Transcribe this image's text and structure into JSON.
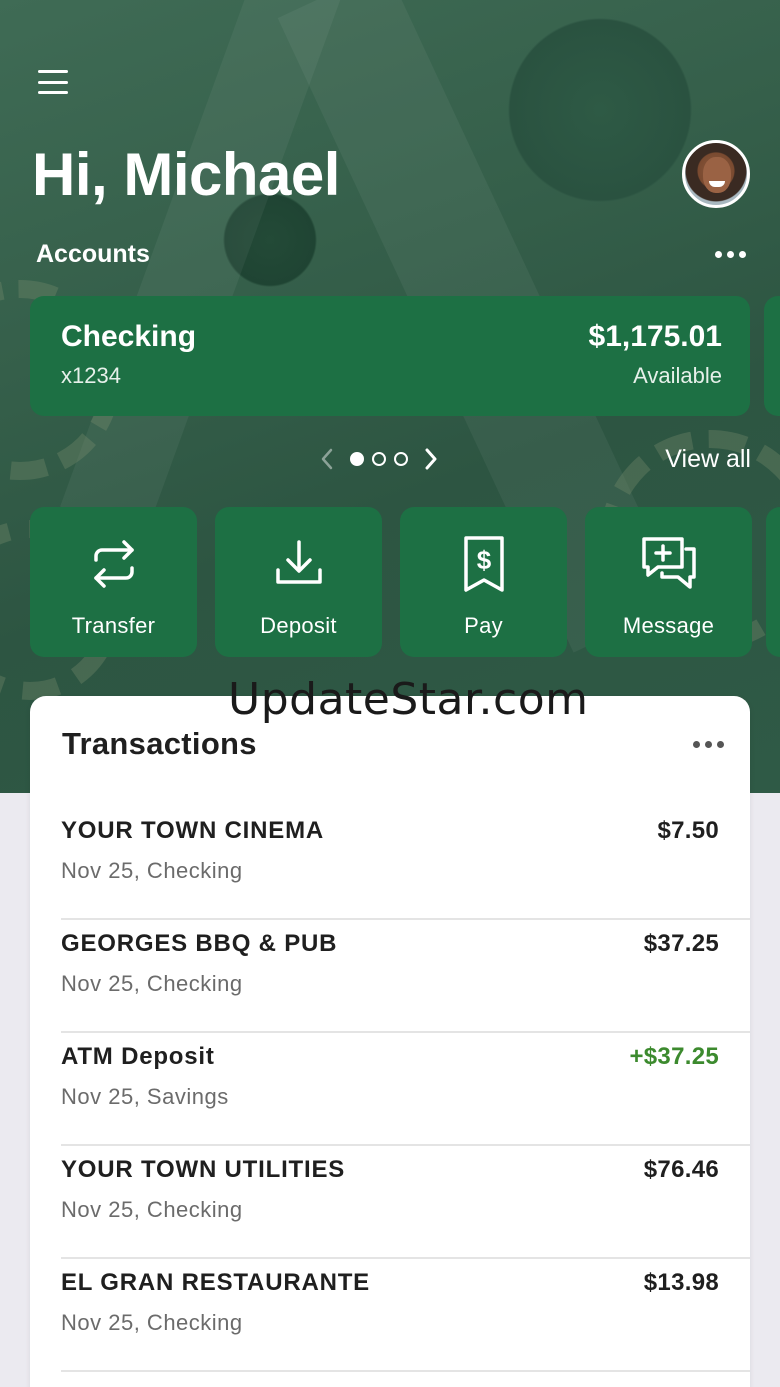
{
  "header": {
    "greeting": "Hi, Michael",
    "accounts_label": "Accounts"
  },
  "account_card": {
    "name": "Checking",
    "number": "x1234",
    "balance": "$1,175.01",
    "balance_label": "Available"
  },
  "carousel": {
    "pages": 3,
    "active_page": 1,
    "view_all_label": "View all"
  },
  "actions": [
    {
      "label": "Transfer",
      "icon": "transfer-icon"
    },
    {
      "label": "Deposit",
      "icon": "deposit-icon"
    },
    {
      "label": "Pay",
      "icon": "pay-bill-icon"
    },
    {
      "label": "Message",
      "icon": "message-add-icon"
    }
  ],
  "watermark": "UpdateStar.com",
  "transactions": {
    "title": "Transactions",
    "items": [
      {
        "merchant": "YOUR TOWN CINEMA",
        "meta": "Nov 25, Checking",
        "amount": "$7.50",
        "credit": false
      },
      {
        "merchant": "GEORGES BBQ & PUB",
        "meta": "Nov 25, Checking",
        "amount": "$37.25",
        "credit": false
      },
      {
        "merchant": "ATM Deposit",
        "meta": "Nov 25, Savings",
        "amount": "+$37.25",
        "credit": true
      },
      {
        "merchant": "YOUR TOWN UTILITIES",
        "meta": "Nov 25, Checking",
        "amount": "$76.46",
        "credit": false
      },
      {
        "merchant": "EL GRAN RESTAURANTE",
        "meta": "Nov 25, Checking",
        "amount": "$13.98",
        "credit": false
      }
    ]
  },
  "colors": {
    "brand_green": "#1d7044",
    "credit_green": "#3c8a2e"
  }
}
